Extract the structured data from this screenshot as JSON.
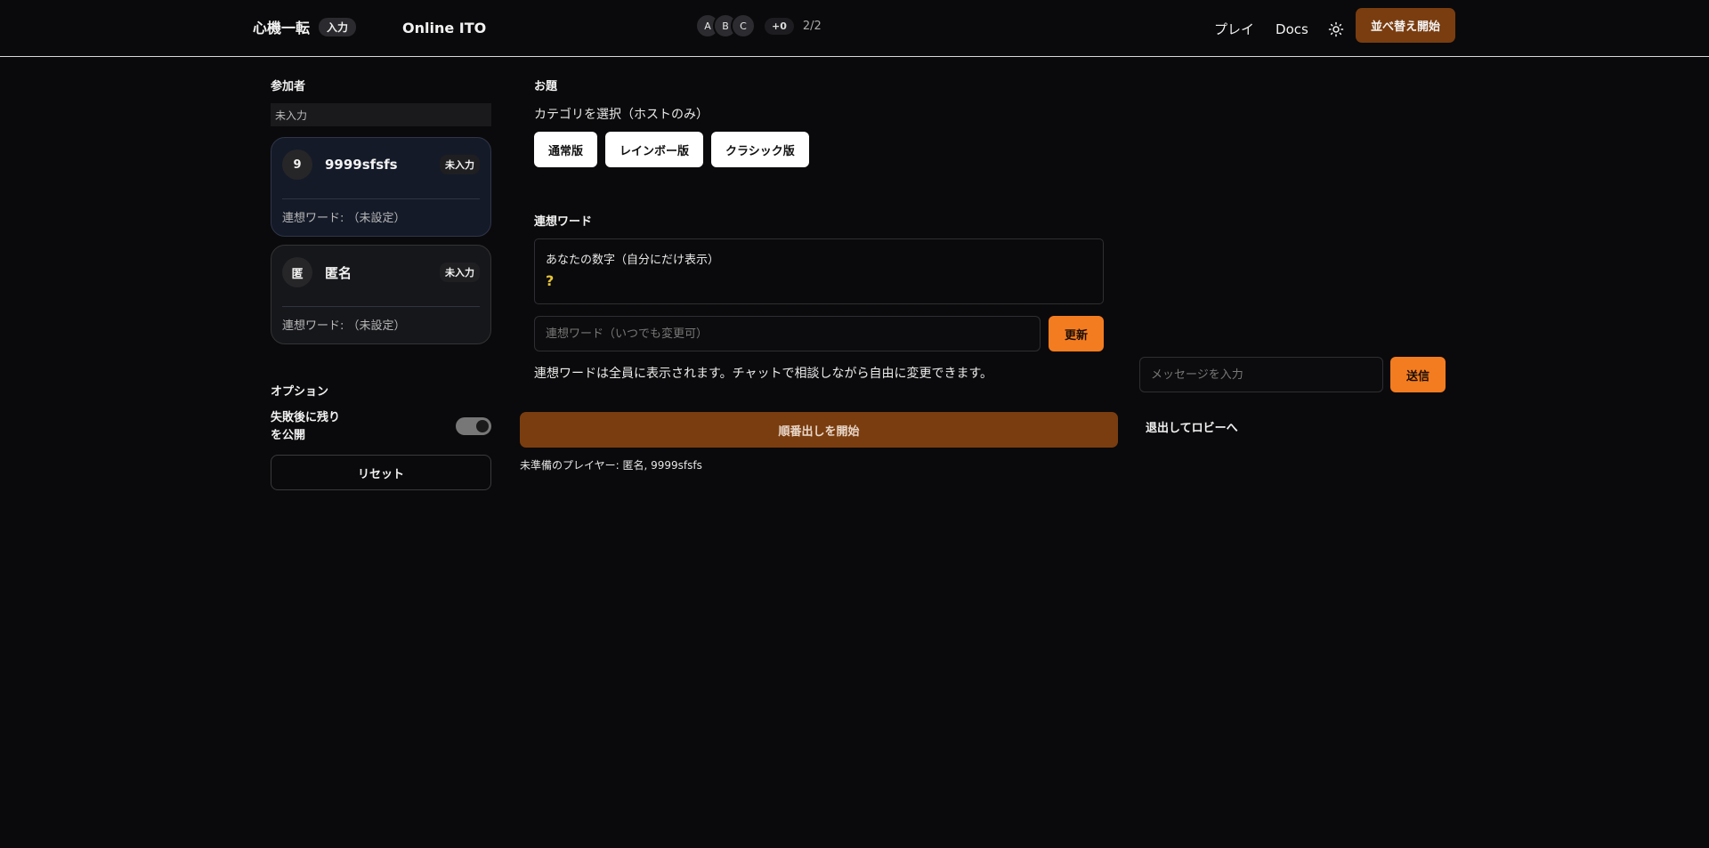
{
  "header": {
    "brand": "心機一転",
    "mode_badge": "入力",
    "app_title": "Online ITO",
    "avatars": [
      "A",
      "B",
      "C"
    ],
    "avatars_more": "+0",
    "player_count": "2/2",
    "nav": {
      "play": "プレイ",
      "docs": "Docs"
    },
    "cta": "並べ替え開始"
  },
  "sidebar": {
    "participants_title": "参加者",
    "status_strip": "未入力",
    "players": [
      {
        "initial": "9",
        "name": "9999sfsfs",
        "badge": "未入力",
        "word": "連想ワード: （未設定）"
      },
      {
        "initial": "匿",
        "name": "匿名",
        "badge": "未入力",
        "word": "連想ワード: （未設定）"
      }
    ],
    "options_title": "オプション",
    "option_label": "失敗後に残りを公開",
    "option_enabled": true,
    "reset_label": "リセット"
  },
  "main": {
    "topic_title": "お題",
    "category_label": "カテゴリを選択（ホストのみ）",
    "categories": [
      "通常版",
      "レインボー版",
      "クラシック版"
    ],
    "word_title": "連想ワード",
    "number_label": "あなたの数字（自分にだけ表示）",
    "number_value": "?",
    "word_placeholder": "連想ワード（いつでも変更可）",
    "update_label": "更新",
    "word_note": "連想ワードは全員に表示されます。チャットで相談しながら自由に変更できます。",
    "start_label": "順番出しを開始",
    "unready_text": "未準備のプレイヤー: 匿名, 9999sfsfs"
  },
  "chat": {
    "placeholder": "メッセージを入力",
    "send_label": "送信",
    "leave_label": "退出してロビーへ"
  },
  "colors": {
    "accent": "#f47c20",
    "accent_dark": "#7a3d10",
    "background": "#0a0a0c",
    "number_highlight": "#e6c33b"
  }
}
